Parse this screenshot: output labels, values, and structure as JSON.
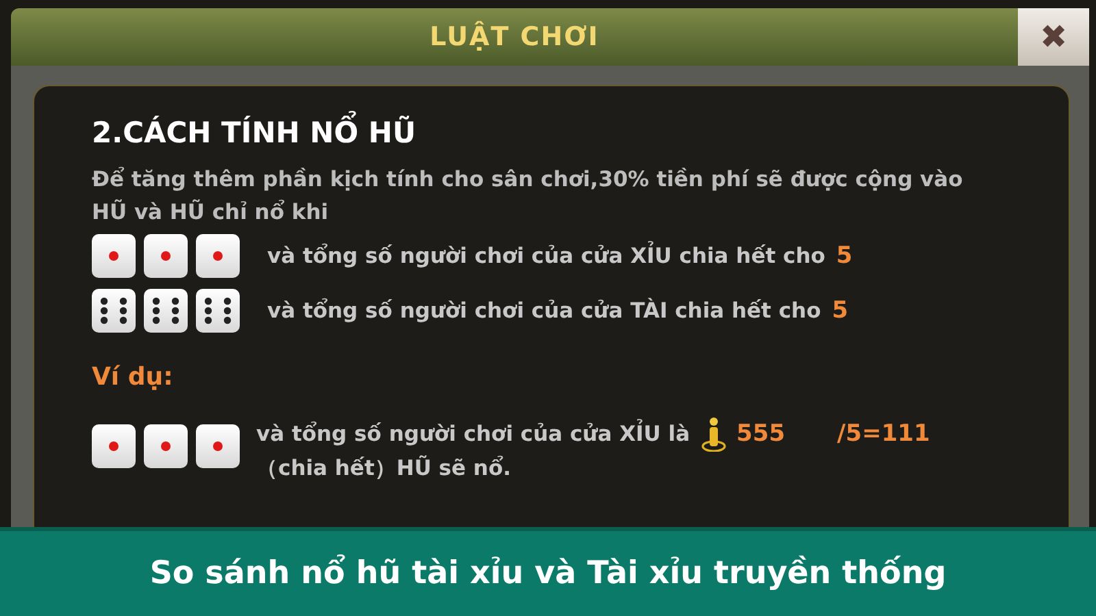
{
  "dialog": {
    "title": "LUẬT CHƠI",
    "close": "✖"
  },
  "section": {
    "heading": "2.CÁCH TÍNH NỔ HŨ",
    "intro": "Để tăng thêm phần kịch tính cho sân chơi,30% tiền phí sẽ được cộng vào HŨ và HŨ chỉ nổ khi",
    "rules": [
      {
        "dice": [
          {
            "kind": "one"
          },
          {
            "kind": "one"
          },
          {
            "kind": "one"
          }
        ],
        "text": "và tổng số người chơi của cửa XỈU chia hết cho",
        "value": "5"
      },
      {
        "dice": [
          {
            "kind": "six"
          },
          {
            "kind": "six"
          },
          {
            "kind": "six"
          }
        ],
        "text": "và tổng số người chơi của cửa TÀI chia hết cho",
        "value": "5"
      }
    ],
    "example": {
      "label": "Ví dụ:",
      "dice": [
        {
          "kind": "one"
        },
        {
          "kind": "one"
        },
        {
          "kind": "one"
        }
      ],
      "text": "và tổng số người chơi của cửa XỈU là",
      "count": "555",
      "result": "/5=111",
      "note": "（chia hết）HŨ sẽ nổ."
    }
  },
  "caption": "So sánh nổ hũ tài xỉu và Tài xỉu truyền thống"
}
